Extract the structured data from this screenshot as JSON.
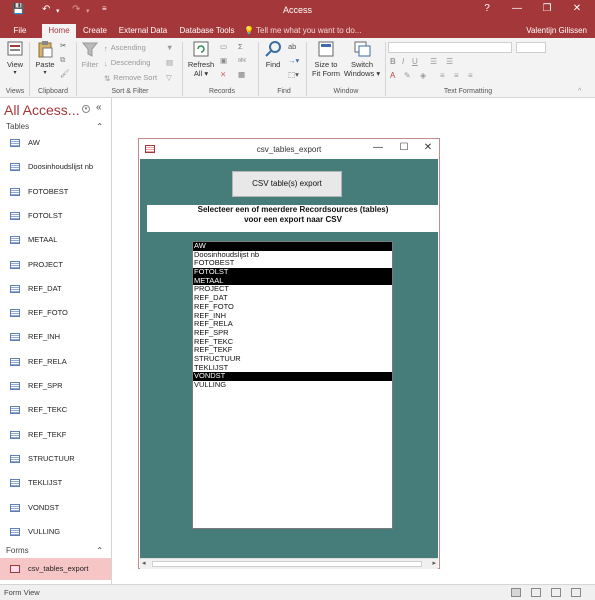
{
  "window": {
    "app_title": "Access",
    "help_glyph": "?",
    "minimize_glyph": "—",
    "restore_glyph": "❐",
    "close_glyph": "✕"
  },
  "tabs": [
    "File",
    "Home",
    "Create",
    "External Data",
    "Database Tools"
  ],
  "active_tab": "Home",
  "tell_me": "Tell me what you want to do...",
  "user": "Valentijn Gilissen",
  "ribbon": {
    "view": "View",
    "paste": "Paste",
    "filter": "Filter",
    "ascending": "Ascending",
    "descending": "Descending",
    "remove_sort": "Remove Sort",
    "refresh": "Refresh",
    "refresh_all": "All",
    "find": "Find",
    "size_to_fit": "Size to",
    "fit_form": "Fit Form",
    "switch": "Switch",
    "windows": "Windows",
    "groups": {
      "views": "Views",
      "clipboard": "Clipboard",
      "sort_filter": "Sort & Filter",
      "records": "Records",
      "find": "Find",
      "window": "Window",
      "text_formatting": "Text Formatting"
    }
  },
  "nav": {
    "title": "All Access...",
    "tables_header": "Tables",
    "tables": [
      "AW",
      "Doosinhoudslijst nb",
      "FOTOBEST",
      "FOTOLST",
      "METAAL",
      "PROJECT",
      "REF_DAT",
      "REF_FOTO",
      "REF_INH",
      "REF_RELA",
      "REF_SPR",
      "REF_TEKC",
      "REF_TEKF",
      "STRUCTUUR",
      "TEKLIJST",
      "VONDST",
      "VULLING"
    ],
    "forms_header": "Forms",
    "forms": [
      "csv_tables_export"
    ]
  },
  "form": {
    "title": "csv_tables_export",
    "button": "CSV table(s) export",
    "info_line1": "Selecteer een of meerdere Recordsources (tables)",
    "info_line2": "voor een export naar CSV",
    "list": [
      {
        "label": "AW",
        "selected": true
      },
      {
        "label": "Doosinhoudslijst nb",
        "selected": false
      },
      {
        "label": "FOTOBEST",
        "selected": false
      },
      {
        "label": "FOTOLST",
        "selected": true
      },
      {
        "label": "METAAL",
        "selected": true
      },
      {
        "label": "PROJECT",
        "selected": false
      },
      {
        "label": "REF_DAT",
        "selected": false
      },
      {
        "label": "REF_FOTO",
        "selected": false
      },
      {
        "label": "REF_INH",
        "selected": false
      },
      {
        "label": "REF_RELA",
        "selected": false
      },
      {
        "label": "REF_SPR",
        "selected": false
      },
      {
        "label": "REF_TEKC",
        "selected": false
      },
      {
        "label": "REF_TEKF",
        "selected": false
      },
      {
        "label": "STRUCTUUR",
        "selected": false
      },
      {
        "label": "TEKLIJST",
        "selected": false
      },
      {
        "label": "VONDST",
        "selected": true
      },
      {
        "label": "VULLING",
        "selected": false
      }
    ]
  },
  "status": "Form View",
  "colors": {
    "accent": "#a4373a",
    "form_bg": "#467c7a",
    "selected_nav": "#f6c6c7"
  }
}
